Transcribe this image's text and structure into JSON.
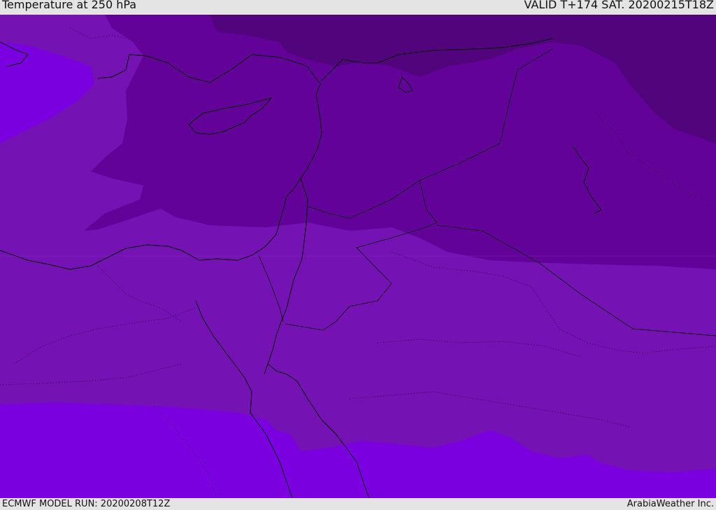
{
  "header": {
    "title": "Temperature at 250 hPa",
    "valid": "VALID T+174 SAT. 20200215T18Z"
  },
  "footer": {
    "model_run": "ECMWF MODEL RUN: 20200208T12Z",
    "credit": "ArabiaWeather Inc."
  },
  "map": {
    "colors": {
      "band_cold": "#52047c",
      "band_cool": "#620298",
      "band_mid": "#7412b4",
      "band_warm": "#7a00e0",
      "coastline": "#000000"
    }
  }
}
